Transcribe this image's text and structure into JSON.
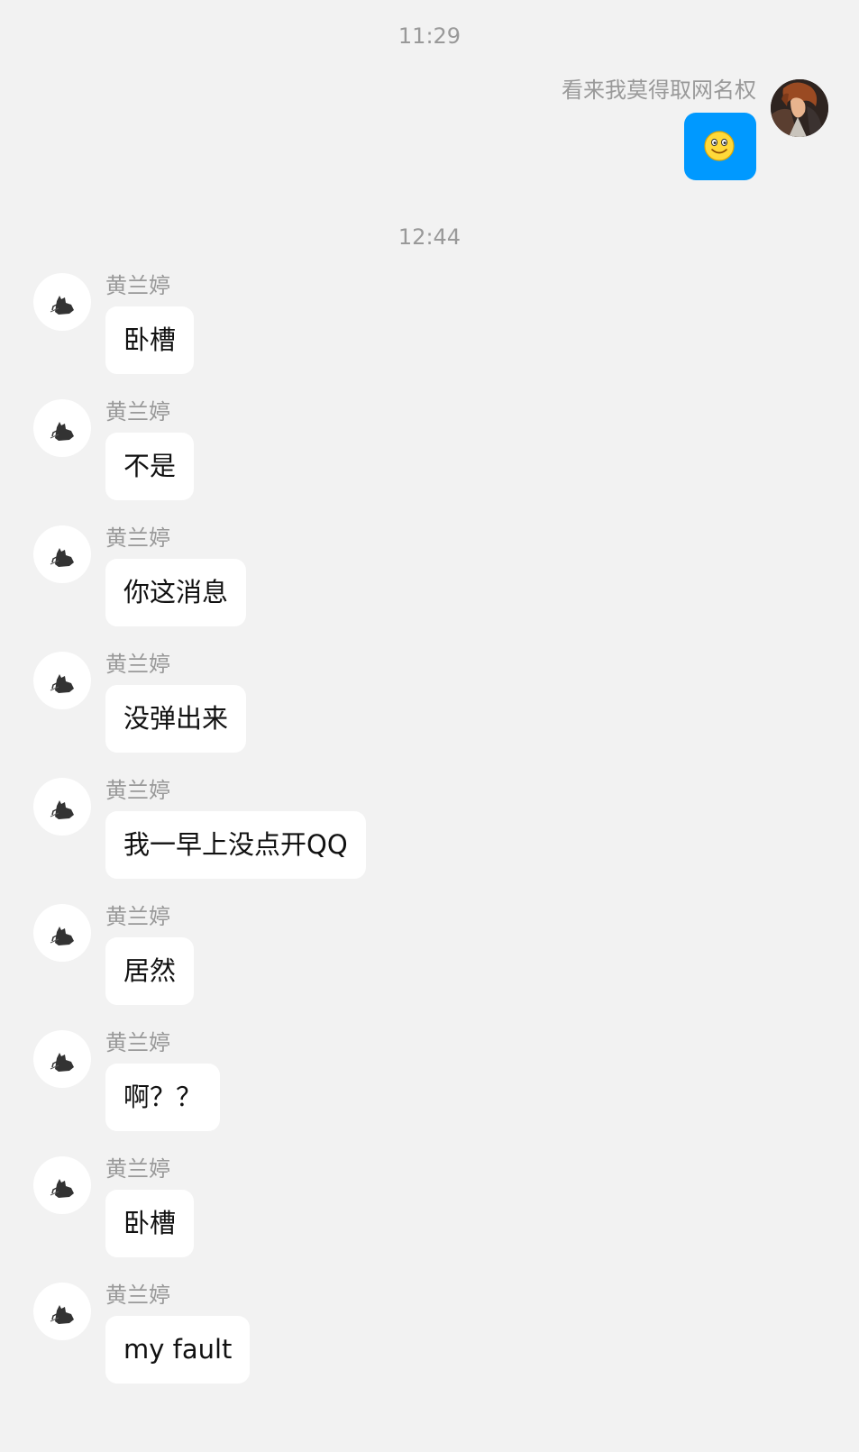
{
  "timestamps": [
    "11:29",
    "12:44"
  ],
  "outgoing": {
    "sender_name": "看来我莫得取网名权",
    "content_icon": "smiley-emoji-icon"
  },
  "contact": {
    "name": "黄兰婷"
  },
  "incoming_messages": [
    {
      "text": "卧槽"
    },
    {
      "text": "不是"
    },
    {
      "text": "你这消息"
    },
    {
      "text": "没弹出来"
    },
    {
      "text": "我一早上没点开QQ"
    },
    {
      "text": "居然"
    },
    {
      "text": "啊？？"
    },
    {
      "text": "卧槽"
    },
    {
      "text": "my fault"
    }
  ],
  "colors": {
    "background": "#f2f2f2",
    "outgoing_bubble": "#0099ff",
    "incoming_bubble": "#ffffff",
    "meta_text": "#999999"
  }
}
